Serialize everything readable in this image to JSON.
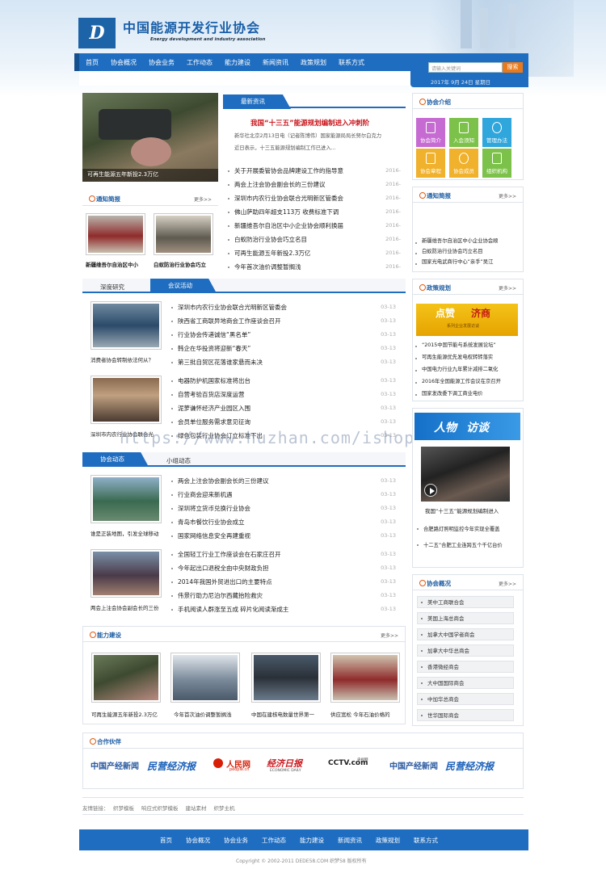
{
  "header": {
    "title": "中国能源开发行业协会",
    "subtitle": "Energy development and industry association",
    "logo_letter": "D"
  },
  "nav": [
    "首页",
    "协会概况",
    "协会业务",
    "工作动态",
    "能力建设",
    "新闻资讯",
    "政策规划",
    "联系方式"
  ],
  "search": {
    "placeholder": "请输入关键词",
    "button": "搜索",
    "date": "2017年 9月 24日  星期日"
  },
  "featured": {
    "caption": "可再生能源五年新投2.3万亿"
  },
  "news": {
    "title": "最新资讯",
    "headline": "我国“十三五”能源规划编制进入冲刺阶",
    "summary_1": "新华社北京2月13日电（记者陈博伟）国家能源局局长努尔白克力",
    "summary_2": "近日表示，十三五能源规划编制工作已进入...",
    "items": [
      {
        "t": "关于开展委管协会品牌建设工作的指导意",
        "d": "2016-"
      },
      {
        "t": "两会上注会协会副会长的三份建议",
        "d": "2016-"
      },
      {
        "t": "深圳市内农行业协会联合光明新区管委会",
        "d": "2016-"
      },
      {
        "t": "佛山萨助四年超支113万 收费标准下调",
        "d": "2016-"
      },
      {
        "t": "新疆维吾尔自治区中小企业协会顺利换届",
        "d": "2016-"
      },
      {
        "t": "白蚁防治行业协会巧立名目",
        "d": "2016-"
      },
      {
        "t": "可再生能源五年新投2.3万亿",
        "d": "2016-"
      },
      {
        "t": "今年首次油价调整暂搁浅",
        "d": "2016-"
      }
    ]
  },
  "notice_left": {
    "title": "通知简报",
    "more": "更多>>",
    "captions": [
      "新疆维吾尔自治区中小",
      "白蚁防治行业协会巧立"
    ]
  },
  "meeting": {
    "tab_grey": "深度研究",
    "tab_blue": "会议活动",
    "captions": [
      "消费者协会转制依法何从？",
      "深圳市内农行业协会联合光"
    ],
    "list1": [
      "深圳市内农行业协会联合光明新区管委会",
      "陕西省工商联异地商会工作座谈会召开",
      "行业协会传递诚信“黑名单”",
      "韩企在华投资将迎新“春天”",
      "第三批自贸区花落谁家悬而未决"
    ],
    "list2": [
      "电器防护机国家标准将出台",
      "自营考验百货店深度运营",
      "泥萝谦怀经济产业园区入围",
      "会员单位服务需求意见征询",
      "绿色包装行业协会订立标准下出"
    ],
    "date": "03-13"
  },
  "activity": {
    "tab_blue": "协会动态",
    "tab_grey": "小组动态",
    "captions": [
      "谁是正装地图，引发全球移动",
      "两会上注会协会副会长的三份"
    ],
    "list1": [
      "两会上注会协会副会长的三份建议",
      "行业商会迎来新机遇",
      "深圳将立货币兑换行业协会",
      "青岛市餐饮行业协会成立",
      "国家网络信息安全再建重视"
    ],
    "list2": [
      "全国轻工行业工作座谈会在石家庄召开",
      "今年起出口退税全由中央财政负担",
      "2014年我国外贸进出口的主要特点",
      "伟景行助力尼泊尔西藏抬险救灾",
      "手机阅读人群涨至五成 碎片化阅读渐成主"
    ],
    "date": "03-13"
  },
  "capacity": {
    "title": "能力建设",
    "more": "更多>>",
    "captions": [
      "可再生能源五年新投2.3万亿",
      "今年首次油价调整暂搁浅",
      "中国在建核电数量世界第一",
      "供应宽松 今年石油价格的"
    ]
  },
  "partners": {
    "title": "合作伙伴",
    "logos": [
      "中国产经新闻",
      "民营经济报",
      "人民网",
      "经济日报",
      "CCTV.com",
      "中国产经新闻",
      "民营经济报"
    ],
    "logo_sub": [
      "people.cn",
      "ECONOMIC DAILY",
      "央视网"
    ]
  },
  "links": {
    "label": "友情链接：",
    "items": [
      "织梦模板",
      "响应式织梦模板",
      "建站素材",
      "织梦主机"
    ]
  },
  "intro": {
    "title": "协会介绍",
    "icons": [
      "协会简介",
      "入会须知",
      "管理办法",
      "协会章程",
      "协会成员",
      "组织机构"
    ]
  },
  "notice_right": {
    "title": "通知简报",
    "more": "更多>>",
    "items": [
      "新疆维吾尔自治区中小企业协会顺",
      "白蚁防治行业协会巧立名目",
      "国家光电武商行中心”亲手”吴江"
    ]
  },
  "policy": {
    "title": "政策规划",
    "more": "更多>>",
    "banner_1": "点赞",
    "banner_2": "济商",
    "banner_sub": "系列企业发展访谈",
    "items": [
      "“2015中国节能与系统发展论坛”",
      "可再生能源优先发电权转转落实",
      "中国电力行业九年累计减排二氧化",
      "2016年全国能源工作会议在京召开",
      "国家发改委下调工商业电价"
    ]
  },
  "interview": {
    "banner": "人物",
    "banner_2": "访谈",
    "caption": "我国“十三五”能源规划编制进入",
    "items": [
      "合肥路灯照明监控今年实现全覆盖",
      "十二五”合肥工业连跨五个千亿台价"
    ]
  },
  "assoc": {
    "title": "协会概况",
    "more": "更多>>",
    "items": [
      "美中工商联合会",
      "美国上海总商会",
      "加拿大中国学者商会",
      "加拿大中华总商会",
      "香港微经商会",
      "大中国国际商会",
      "中加华总商会",
      "世华国际商会"
    ]
  },
  "footer": {
    "nav": [
      "首页",
      "协会概况",
      "协会业务",
      "工作动态",
      "能力建设",
      "新闻资讯",
      "政策规划",
      "联系方式"
    ],
    "copyright": "Copyright © 2002-2011 DEDE58.COM 织梦58 版权所有"
  },
  "watermark": "https://www.huzhan.com/ishop15989",
  "colors": {
    "primary": "#1f6dc0",
    "accent": "#e87a1c"
  }
}
